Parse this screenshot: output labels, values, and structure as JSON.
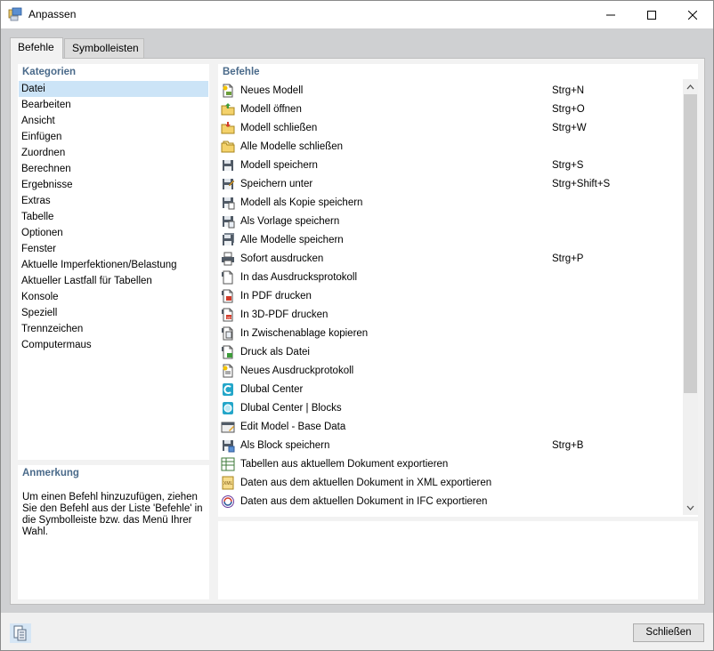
{
  "window": {
    "title": "Anpassen"
  },
  "tabs": [
    {
      "label": "Befehle"
    },
    {
      "label": "Symbolleisten"
    }
  ],
  "categories": {
    "header": "Kategorien",
    "items": [
      {
        "label": "Datei",
        "selected": true
      },
      {
        "label": "Bearbeiten"
      },
      {
        "label": "Ansicht"
      },
      {
        "label": "Einfügen"
      },
      {
        "label": "Zuordnen"
      },
      {
        "label": "Berechnen"
      },
      {
        "label": "Ergebnisse"
      },
      {
        "label": "Extras"
      },
      {
        "label": "Tabelle"
      },
      {
        "label": "Optionen"
      },
      {
        "label": "Fenster"
      },
      {
        "label": "Aktuelle Imperfektionen/Belastung"
      },
      {
        "label": "Aktueller Lastfall für Tabellen"
      },
      {
        "label": "Konsole"
      },
      {
        "label": "Speziell"
      },
      {
        "label": "Trennzeichen"
      },
      {
        "label": "Computermaus"
      }
    ]
  },
  "note": {
    "header": "Anmerkung",
    "text": "Um einen Befehl hinzuzufügen, ziehen Sie den Befehl aus der Liste 'Befehle' in die Symbolleiste bzw. das Menü Ihrer Wahl."
  },
  "commands": {
    "header": "Befehle",
    "items": [
      {
        "icon": "new-model-icon",
        "label": "Neues Modell",
        "shortcut": "Strg+N"
      },
      {
        "icon": "open-model-icon",
        "label": "Modell öffnen",
        "shortcut": "Strg+O"
      },
      {
        "icon": "close-model-icon",
        "label": "Modell schließen",
        "shortcut": "Strg+W"
      },
      {
        "icon": "close-all-models-icon",
        "label": "Alle Modelle schließen",
        "shortcut": ""
      },
      {
        "icon": "save-model-icon",
        "label": "Modell speichern",
        "shortcut": "Strg+S"
      },
      {
        "icon": "save-as-icon",
        "label": "Speichern unter",
        "shortcut": "Strg+Shift+S"
      },
      {
        "icon": "save-copy-icon",
        "label": "Modell als Kopie speichern",
        "shortcut": ""
      },
      {
        "icon": "save-template-icon",
        "label": "Als Vorlage speichern",
        "shortcut": ""
      },
      {
        "icon": "save-all-icon",
        "label": "Alle Modelle speichern",
        "shortcut": ""
      },
      {
        "icon": "print-icon",
        "label": "Sofort ausdrucken",
        "shortcut": "Strg+P"
      },
      {
        "icon": "print-report-icon",
        "label": "In das Ausdrucksprotokoll",
        "shortcut": ""
      },
      {
        "icon": "pdf-print-icon",
        "label": "In PDF drucken",
        "shortcut": ""
      },
      {
        "icon": "3d-pdf-print-icon",
        "label": "In 3D-PDF drucken",
        "shortcut": ""
      },
      {
        "icon": "clipboard-copy-icon",
        "label": "In Zwischenablage kopieren",
        "shortcut": ""
      },
      {
        "icon": "print-file-icon",
        "label": "Druck als Datei",
        "shortcut": ""
      },
      {
        "icon": "new-report-icon",
        "label": "Neues Ausdruckprotokoll",
        "shortcut": ""
      },
      {
        "icon": "dlubal-center-icon",
        "label": "Dlubal Center",
        "shortcut": ""
      },
      {
        "icon": "dlubal-blocks-icon",
        "label": "Dlubal Center | Blocks",
        "shortcut": ""
      },
      {
        "icon": "edit-model-icon",
        "label": "Edit Model - Base Data",
        "shortcut": ""
      },
      {
        "icon": "save-block-icon",
        "label": "Als Block speichern",
        "shortcut": "Strg+B"
      },
      {
        "icon": "export-tables-icon",
        "label": "Tabellen aus aktuellem Dokument exportieren",
        "shortcut": ""
      },
      {
        "icon": "export-xml-icon",
        "label": "Daten aus dem aktuellen Dokument in XML exportieren",
        "shortcut": ""
      },
      {
        "icon": "export-ifc-icon",
        "label": "Daten aus dem aktuellen Dokument in IFC exportieren",
        "shortcut": ""
      }
    ]
  },
  "footer": {
    "close_label": "Schließen"
  }
}
